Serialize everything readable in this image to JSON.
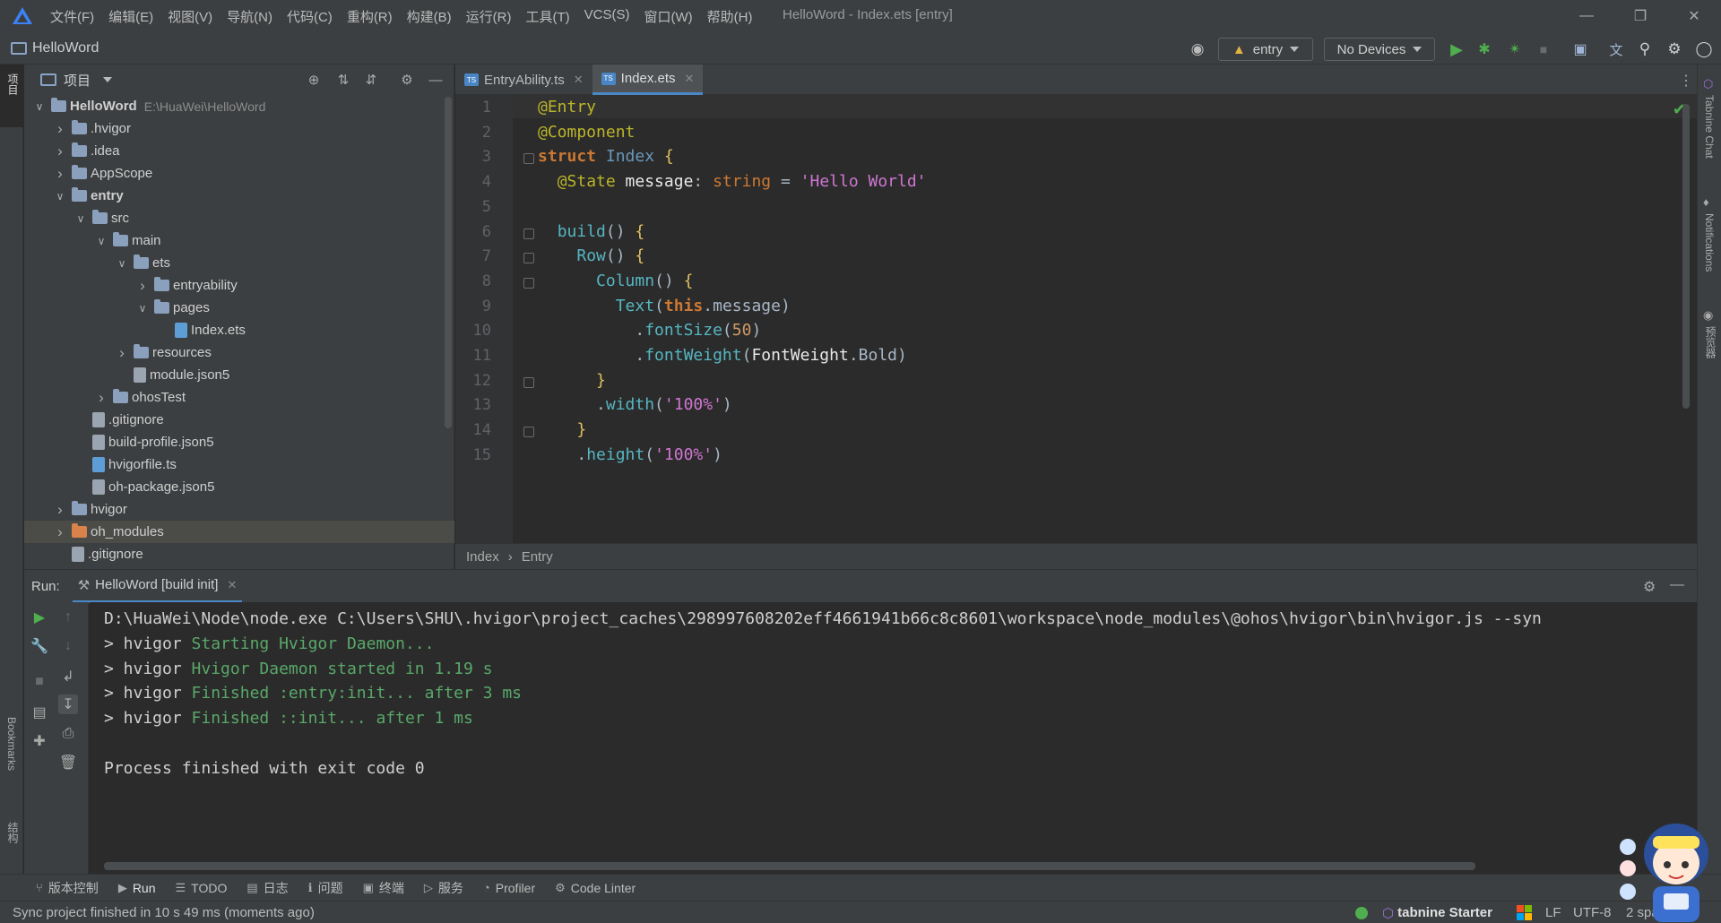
{
  "window": {
    "title": "HelloWord - Index.ets [entry]",
    "menu": [
      "文件(F)",
      "编辑(E)",
      "视图(V)",
      "导航(N)",
      "代码(C)",
      "重构(R)",
      "构建(B)",
      "运行(R)",
      "工具(T)",
      "VCS(S)",
      "窗口(W)",
      "帮助(H)"
    ]
  },
  "navbar": {
    "project_name": "HelloWord",
    "run_config": "entry",
    "device": "No Devices"
  },
  "left_strip": {
    "project_tab": "项目",
    "bookmarks_tab": "Bookmarks",
    "structure_tab": "结构"
  },
  "right_strip": {
    "tabnine_tab": "Tabnine Chat",
    "notifications_tab": "Notifications",
    "preview_tab": "预览器"
  },
  "project_panel": {
    "header_label": "项目",
    "tree": [
      {
        "label": "HelloWord",
        "path": "E:\\HuaWei\\HelloWord",
        "depth": 0,
        "arrow": "down",
        "kind": "root",
        "bold": true
      },
      {
        "label": ".hvigor",
        "depth": 1,
        "arrow": "right",
        "kind": "folder"
      },
      {
        "label": ".idea",
        "depth": 1,
        "arrow": "right",
        "kind": "folder"
      },
      {
        "label": "AppScope",
        "depth": 1,
        "arrow": "right",
        "kind": "folder"
      },
      {
        "label": "entry",
        "depth": 1,
        "arrow": "down",
        "kind": "folder",
        "bold": true
      },
      {
        "label": "src",
        "depth": 2,
        "arrow": "down",
        "kind": "folder"
      },
      {
        "label": "main",
        "depth": 3,
        "arrow": "down",
        "kind": "folder"
      },
      {
        "label": "ets",
        "depth": 4,
        "arrow": "down",
        "kind": "folder"
      },
      {
        "label": "entryability",
        "depth": 5,
        "arrow": "right",
        "kind": "folder"
      },
      {
        "label": "pages",
        "depth": 5,
        "arrow": "down",
        "kind": "folder"
      },
      {
        "label": "Index.ets",
        "depth": 6,
        "arrow": "",
        "kind": "ts"
      },
      {
        "label": "resources",
        "depth": 4,
        "arrow": "right",
        "kind": "folder"
      },
      {
        "label": "module.json5",
        "depth": 4,
        "arrow": "",
        "kind": "file"
      },
      {
        "label": "ohosTest",
        "depth": 3,
        "arrow": "right",
        "kind": "folder"
      },
      {
        "label": ".gitignore",
        "depth": 2,
        "arrow": "",
        "kind": "file"
      },
      {
        "label": "build-profile.json5",
        "depth": 2,
        "arrow": "",
        "kind": "file"
      },
      {
        "label": "hvigorfile.ts",
        "depth": 2,
        "arrow": "",
        "kind": "ts"
      },
      {
        "label": "oh-package.json5",
        "depth": 2,
        "arrow": "",
        "kind": "file"
      },
      {
        "label": "hvigor",
        "depth": 1,
        "arrow": "right",
        "kind": "folder"
      },
      {
        "label": "oh_modules",
        "depth": 1,
        "arrow": "right",
        "kind": "folder-orange",
        "selected": true
      },
      {
        "label": ".gitignore",
        "depth": 1,
        "arrow": "",
        "kind": "file"
      }
    ]
  },
  "editor": {
    "tabs": [
      {
        "label": "EntryAbility.ts",
        "active": false
      },
      {
        "label": "Index.ets",
        "active": true
      }
    ],
    "lines": [
      {
        "n": "1",
        "segs": [
          [
            "ann",
            "@Entry"
          ]
        ]
      },
      {
        "n": "2",
        "segs": [
          [
            "ann",
            "@Component"
          ]
        ]
      },
      {
        "n": "3",
        "segs": [
          [
            "kw",
            "struct "
          ],
          [
            "typ",
            "Index "
          ],
          [
            "brace",
            "{"
          ]
        ]
      },
      {
        "n": "4",
        "segs": [
          [
            "pl",
            "  "
          ],
          [
            "ann",
            "@State "
          ],
          [
            "prop",
            "message"
          ],
          [
            "pl",
            ": "
          ],
          [
            "kw2",
            "string"
          ],
          [
            "pl",
            " = "
          ],
          [
            "str",
            "'Hello World'"
          ]
        ]
      },
      {
        "n": "5",
        "segs": []
      },
      {
        "n": "6",
        "segs": [
          [
            "pl",
            "  "
          ],
          [
            "fn",
            "build"
          ],
          [
            "pl",
            "() "
          ],
          [
            "brace",
            "{"
          ]
        ]
      },
      {
        "n": "7",
        "segs": [
          [
            "pl",
            "    "
          ],
          [
            "fn",
            "Row"
          ],
          [
            "pl",
            "() "
          ],
          [
            "brace",
            "{"
          ]
        ]
      },
      {
        "n": "8",
        "segs": [
          [
            "pl",
            "      "
          ],
          [
            "fn",
            "Column"
          ],
          [
            "pl",
            "() "
          ],
          [
            "brace",
            "{"
          ]
        ]
      },
      {
        "n": "9",
        "segs": [
          [
            "pl",
            "        "
          ],
          [
            "fn",
            "Text"
          ],
          [
            "pl",
            "("
          ],
          [
            "kw",
            "this"
          ],
          [
            "pl",
            ".message)"
          ]
        ]
      },
      {
        "n": "10",
        "segs": [
          [
            "pl",
            "          ."
          ],
          [
            "fn",
            "fontSize"
          ],
          [
            "pl",
            "("
          ],
          [
            "num",
            "50"
          ],
          [
            "pl",
            ")"
          ]
        ]
      },
      {
        "n": "11",
        "segs": [
          [
            "pl",
            "          ."
          ],
          [
            "fn",
            "fontWeight"
          ],
          [
            "pl",
            "("
          ],
          [
            "prop",
            "FontWeight"
          ],
          [
            "pl",
            ".Bold)"
          ]
        ]
      },
      {
        "n": "12",
        "segs": [
          [
            "pl",
            "      "
          ],
          [
            "brace",
            "}"
          ]
        ]
      },
      {
        "n": "13",
        "segs": [
          [
            "pl",
            "      ."
          ],
          [
            "fn",
            "width"
          ],
          [
            "pl",
            "("
          ],
          [
            "str",
            "'100%'"
          ],
          [
            "pl",
            ")"
          ]
        ]
      },
      {
        "n": "14",
        "segs": [
          [
            "pl",
            "    "
          ],
          [
            "brace",
            "}"
          ]
        ]
      },
      {
        "n": "15",
        "segs": [
          [
            "pl",
            "    ."
          ],
          [
            "fn",
            "height"
          ],
          [
            "pl",
            "("
          ],
          [
            "str",
            "'100%'"
          ],
          [
            "pl",
            ")"
          ]
        ]
      }
    ],
    "breadcrumbs": [
      "Index",
      "Entry"
    ]
  },
  "run_panel": {
    "label": "Run:",
    "tab": "HelloWord [build init]",
    "lines": [
      {
        "prefix": "D:\\HuaWei\\Node\\node.exe C:\\Users\\SHU\\.hvigor\\project_caches\\298997608202eff4661941b66c8c8601\\workspace\\node_modules\\@ohos\\hvigor\\bin\\hvigor.js --syn",
        "green": ""
      },
      {
        "prefix": "> hvigor ",
        "green": "Starting Hvigor Daemon..."
      },
      {
        "prefix": "> hvigor ",
        "green": "Hvigor Daemon started in 1.19 s"
      },
      {
        "prefix": "> hvigor ",
        "green": "Finished :entry:init... after 3 ms"
      },
      {
        "prefix": "> hvigor ",
        "green": "Finished ::init... after 1 ms"
      },
      {
        "prefix": "",
        "green": ""
      },
      {
        "prefix": "Process finished with exit code 0",
        "green": ""
      }
    ]
  },
  "bottom_tools": [
    {
      "label": "版本控制",
      "icon": "branch-icon",
      "active": false
    },
    {
      "label": "Run",
      "icon": "play-icon",
      "active": true
    },
    {
      "label": "TODO",
      "icon": "list-icon",
      "active": false
    },
    {
      "label": "日志",
      "icon": "log-icon",
      "active": false
    },
    {
      "label": "问题",
      "icon": "info-icon",
      "active": false
    },
    {
      "label": "终端",
      "icon": "terminal-icon",
      "active": false
    },
    {
      "label": "服务",
      "icon": "services-icon",
      "active": false
    },
    {
      "label": "Profiler",
      "icon": "profiler-icon",
      "active": false
    },
    {
      "label": "Code Linter",
      "icon": "linter-icon",
      "active": false
    }
  ],
  "status": {
    "message": "Sync project finished in 10 s 49 ms (moments ago)",
    "tabnine": "tabnine Starter",
    "line_sep": "LF",
    "encoding": "UTF-8",
    "indent": "2 spa"
  },
  "colors": {
    "accent": "#4a88c7",
    "run_green": "#4fae4f",
    "console_green": "#59a869"
  }
}
